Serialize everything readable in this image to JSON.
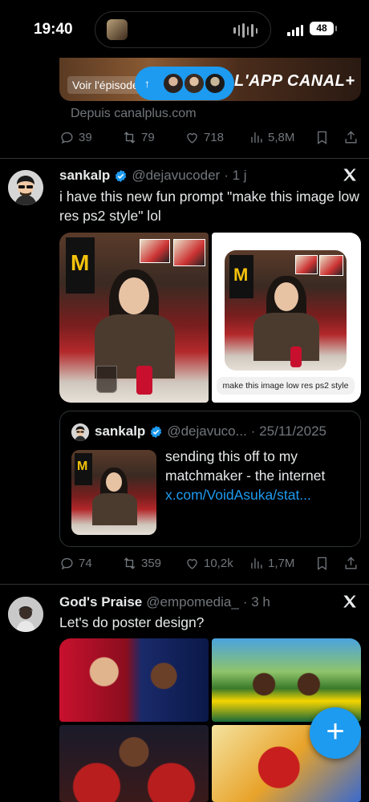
{
  "status_bar": {
    "time": "19:40",
    "battery": "48"
  },
  "top_post": {
    "ad_cta": "Voir l'épisode",
    "ad_brand": "L'APP CANAL+",
    "source": "Depuis canalplus.com",
    "stats": {
      "replies": "39",
      "reposts": "79",
      "likes": "718",
      "views": "5,8M"
    }
  },
  "new_posts_pill": {
    "icon": "arrow-up-icon"
  },
  "posts": [
    {
      "name": "sankalp",
      "verified": true,
      "handle": "@dejavucoder",
      "time": "· 1 j",
      "text": "i have this new fun prompt \"make this image low res ps2 style\" lol",
      "media_right_caption": "make this image low res ps2 style",
      "quote": {
        "name": "sankalp",
        "handle": "@dejavuco...",
        "date": "· 25/11/2025",
        "text": "sending this off to my matchmaker - the internet",
        "link": "x.com/VoidAsuka/stat..."
      },
      "stats": {
        "replies": "74",
        "reposts": "359",
        "likes": "10,2k",
        "views": "1,7M"
      }
    },
    {
      "name": "God's Praise",
      "verified": false,
      "handle": "@empomedia_",
      "time": "· 3 h",
      "text": "Let's do poster design?"
    }
  ],
  "fab": {
    "label": "+"
  },
  "colors": {
    "accent": "#1d9bf0",
    "muted": "#71767b",
    "divider": "#2f3336"
  }
}
